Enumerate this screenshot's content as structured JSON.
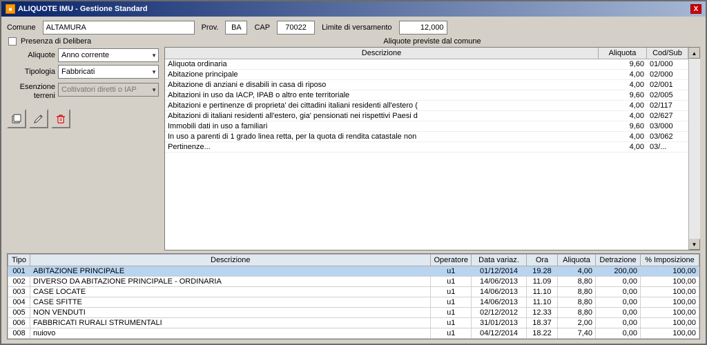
{
  "window": {
    "title": "ALIQUOTE IMU - Gestione Standard",
    "close_label": "X"
  },
  "form": {
    "comune_label": "Comune",
    "comune_value": "ALTAMURA",
    "prov_label": "Prov.",
    "prov_value": "BA",
    "cap_label": "CAP",
    "cap_value": "70022",
    "limite_label": "Limite di versamento",
    "limite_value": "12,000",
    "delibera_label": "Presenza di Delibera",
    "aliquote_label": "Aliquote",
    "aliquote_value": "Anno corrente",
    "tipologia_label": "Tipologia",
    "tipologia_value": "Fabbricati",
    "esenzione_label": "Esenzione\nterreni",
    "esenzione_value": "Coltivatori diretti o IAP"
  },
  "aliquote_section": {
    "title": "Aliquote previste dal comune",
    "col_desc": "Descrizione",
    "col_aliq": "Aliquota",
    "col_cod": "Cod/Sub",
    "rows": [
      {
        "desc": "Aliquota ordinaria",
        "aliq": "9,60",
        "cod": "01/000"
      },
      {
        "desc": "Abitazione principale",
        "aliq": "4,00",
        "cod": "02/000"
      },
      {
        "desc": "Abitazione di anziani e disabili in casa di riposo",
        "aliq": "4,00",
        "cod": "02/001"
      },
      {
        "desc": "Abitazioni in uso da IACP, IPAB o altro ente territoriale",
        "aliq": "9,60",
        "cod": "02/005"
      },
      {
        "desc": "Abitazioni e pertinenze di proprieta' dei cittadini italiani residenti all'estero (",
        "aliq": "4,00",
        "cod": "02/117"
      },
      {
        "desc": "Abitazioni di italiani residenti all'estero, gia' pensionati nei rispettivi Paesi d",
        "aliq": "4,00",
        "cod": "02/627"
      },
      {
        "desc": "Immobili dati in uso a familiari",
        "aliq": "9,60",
        "cod": "03/000"
      },
      {
        "desc": "In uso a parenti di 1 grado linea retta, per la quota di rendita catastale non",
        "aliq": "4,00",
        "cod": "03/062"
      },
      {
        "desc": "Pertinenze...",
        "aliq": "4,00",
        "cod": "03/..."
      }
    ]
  },
  "buttons": {
    "btn1_icon": "📋",
    "btn2_icon": "✏️",
    "btn3_icon": "🗑️"
  },
  "data_table": {
    "columns": [
      "Tipo",
      "Descrizione",
      "Operatore",
      "Data variaz.",
      "Ora",
      "Aliquota",
      "Detrazione",
      "% Imposizione"
    ],
    "rows": [
      {
        "tipo": "001",
        "desc": "ABITAZIONE PRINCIPALE",
        "op": "u1",
        "data": "01/12/2014",
        "ora": "19.28",
        "aliq": "4,00",
        "det": "200,00",
        "imp": "100,00",
        "selected": true
      },
      {
        "tipo": "002",
        "desc": "DIVERSO DA ABITAZIONE PRINCIPALE - ORDINARIA",
        "op": "u1",
        "data": "14/06/2013",
        "ora": "11.09",
        "aliq": "8,80",
        "det": "0,00",
        "imp": "100,00",
        "selected": false
      },
      {
        "tipo": "003",
        "desc": "CASE LOCATE",
        "op": "u1",
        "data": "14/06/2013",
        "ora": "11.10",
        "aliq": "8,80",
        "det": "0,00",
        "imp": "100,00",
        "selected": false
      },
      {
        "tipo": "004",
        "desc": "CASE SFITTE",
        "op": "u1",
        "data": "14/06/2013",
        "ora": "11.10",
        "aliq": "8,80",
        "det": "0,00",
        "imp": "100,00",
        "selected": false
      },
      {
        "tipo": "005",
        "desc": "NON VENDUTI",
        "op": "u1",
        "data": "02/12/2012",
        "ora": "12.33",
        "aliq": "8,80",
        "det": "0,00",
        "imp": "100,00",
        "selected": false
      },
      {
        "tipo": "006",
        "desc": "FABBRICATI RURALI STRUMENTALI",
        "op": "u1",
        "data": "31/01/2013",
        "ora": "18.37",
        "aliq": "2,00",
        "det": "0,00",
        "imp": "100,00",
        "selected": false
      },
      {
        "tipo": "008",
        "desc": "nuiovo",
        "op": "u1",
        "data": "04/12/2014",
        "ora": "18.22",
        "aliq": "7,40",
        "det": "0,00",
        "imp": "100,00",
        "selected": false
      }
    ]
  }
}
